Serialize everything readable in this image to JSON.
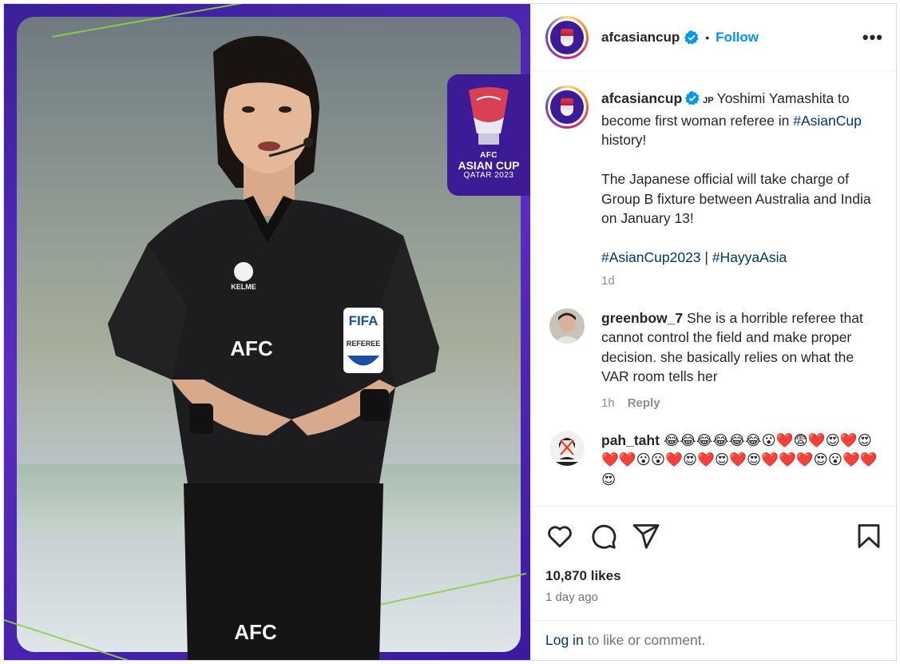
{
  "post": {
    "username": "afcasiancup",
    "follow_label": "Follow",
    "dot": "•",
    "more_label": "•••"
  },
  "badge": {
    "line1": "AFC",
    "line2": "ASIAN CUP",
    "line3": "QATAR 2023"
  },
  "caption": {
    "username": "afcasiancup",
    "flag": "JP",
    "text1": "Yoshimi Yamashita to become first woman referee in ",
    "hashtag1": "#AsianCup",
    "text2": " history!",
    "text3": "The Japanese official will take charge of Group B fixture between Australia and India on January 13!",
    "hashtag2": "#AsianCup2023",
    "sep": " | ",
    "hashtag3": "#HayyaAsia",
    "time": "1d"
  },
  "comments": [
    {
      "username": "greenbow_7",
      "text": "She is a horrible referee that cannot control the field and make proper decision. she basically relies on what the VAR room tells her",
      "time": "1h",
      "reply": "Reply"
    },
    {
      "username": "pah_taht",
      "text": "😂😂😂😂😂😂😮❤️😨❤️😍❤️😍❤️❤️😮😮❤️😍❤️😍❤️😍❤️❤️❤️😍😮❤️❤️😍"
    }
  ],
  "footer": {
    "likes": "10,870 likes",
    "ago": "1 day ago",
    "login_link": "Log in",
    "login_rest": "to like or comment."
  },
  "icons": [
    "heart-icon",
    "comment-icon",
    "share-icon",
    "save-icon",
    "verified-icon"
  ],
  "colors": {
    "follow": "#0095f6",
    "hashtag": "#00376b",
    "badge": "#3d1b96"
  }
}
